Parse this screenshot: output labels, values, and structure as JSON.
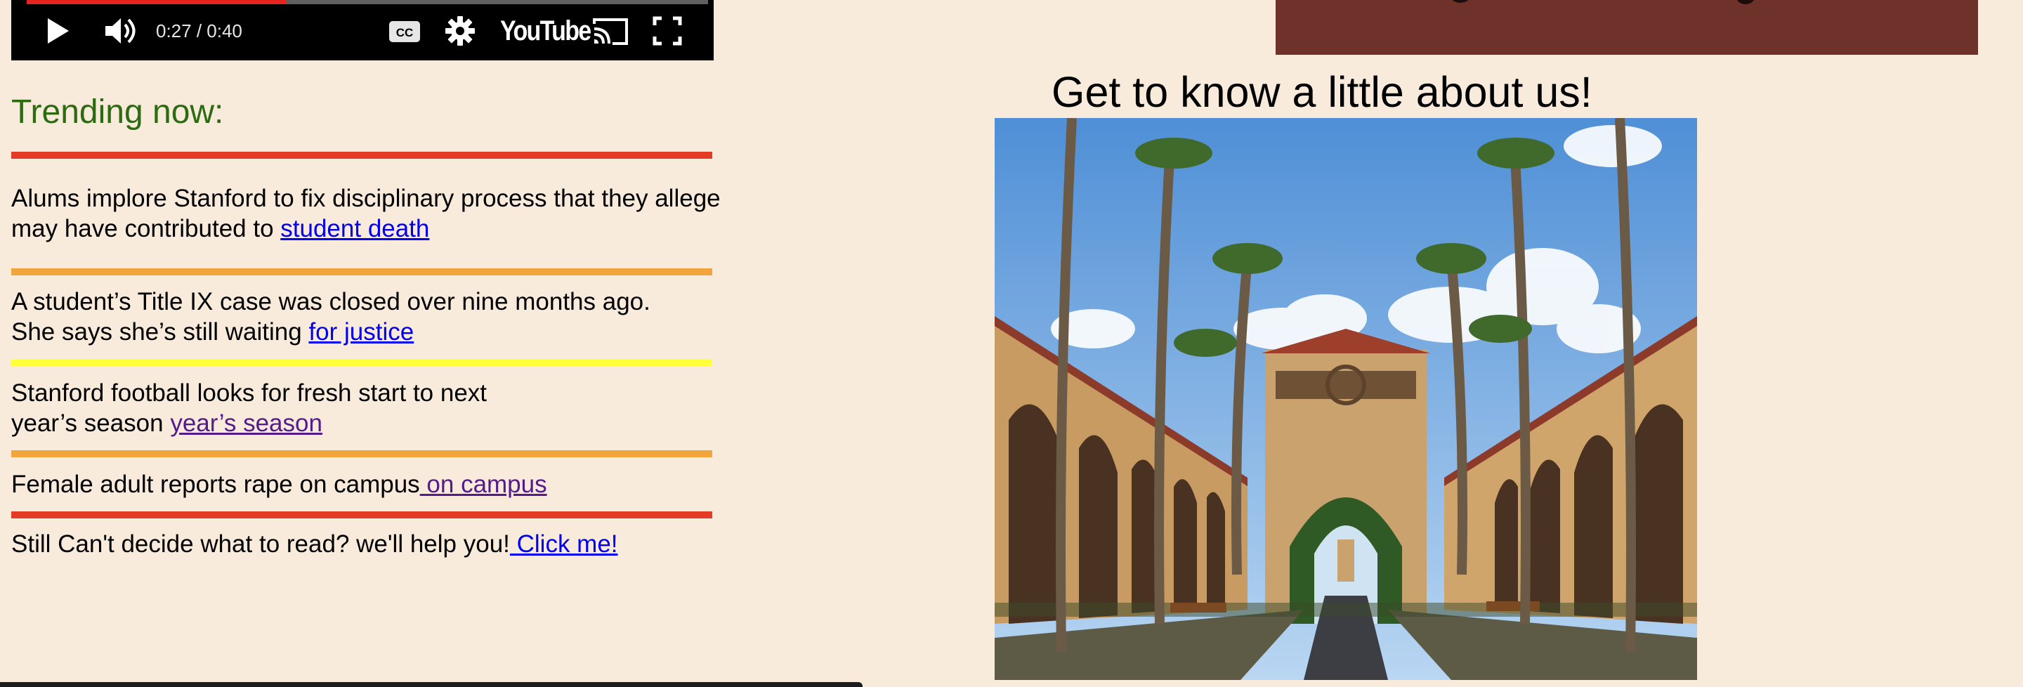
{
  "player": {
    "time": "0:27 / 0:40",
    "progress_fraction": 0.38,
    "brand": "YouTube",
    "controls": [
      "play-icon",
      "volume-icon",
      "captions-icon",
      "gear-icon",
      "cast-icon",
      "fullscreen-icon"
    ],
    "accent_color": "#e8241f"
  },
  "trending": {
    "heading": "Trending now:",
    "items": [
      {
        "lines": [
          "Alums implore Stanford to fix disciplinary process that they allege",
          "may have contributed to "
        ],
        "link": "student death",
        "link_state": "unvisited",
        "divider_color": "#e33b26"
      },
      {
        "lines": [
          "A student’s Title IX case was closed over nine months ago.",
          "She says she’s still waiting "
        ],
        "link": "for justice",
        "link_state": "unvisited",
        "divider_color": "#f2a53b"
      },
      {
        "lines": [
          "Stanford football looks for fresh start to next",
          "year’s season "
        ],
        "link": "year’s season",
        "link_state": "visited",
        "divider_color": "#ffff3a"
      },
      {
        "lines": [
          "Female adult reports rape on campus"
        ],
        "link": " on campus",
        "link_state": "visited",
        "divider_color": "#f2a53b"
      }
    ],
    "final_divider_color": "#e33b26",
    "cta_text": "Still Can't decide what to read? we'll help you!",
    "cta_link": " Click me!"
  },
  "about": {
    "title": "Get to know a little about us!",
    "image": "stanford-main-quad-photo"
  },
  "colors": {
    "page_bg": "#f9ebdb",
    "banner": "#6e322b",
    "heading_green": "#2c6b12",
    "link_blue": "#0000ee",
    "link_visited": "#551a8b"
  }
}
